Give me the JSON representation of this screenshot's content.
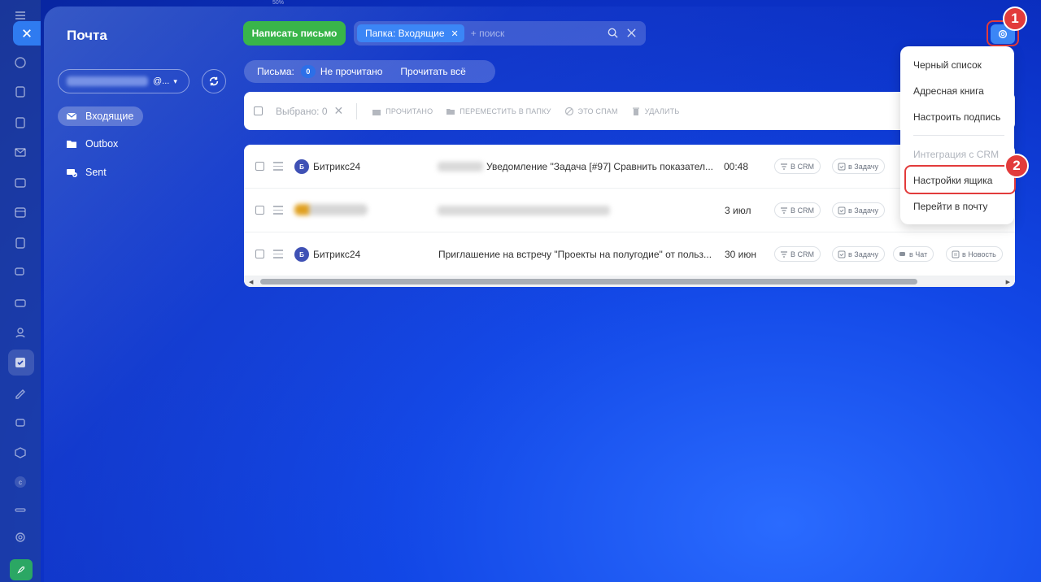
{
  "app": {
    "title": "Почта",
    "topline": "50%"
  },
  "sidebar": {
    "account_domain": "@...",
    "folders": [
      {
        "label": "Входящие",
        "active": true
      },
      {
        "label": "Outbox",
        "active": false
      },
      {
        "label": "Sent",
        "active": false
      }
    ]
  },
  "toolbar": {
    "compose_label": "Написать письмо",
    "filter_chip": "Папка: Входящие",
    "search_placeholder": "+ поиск"
  },
  "counter": {
    "label": "Письма:",
    "count": "0",
    "unread_label": "Не прочитано",
    "read_all_label": "Прочитать всё"
  },
  "action_bar": {
    "selected": "Выбрано: 0",
    "mark_read": "ПРОЧИТАНО",
    "move": "ПЕРЕМЕСТИТЬ В ПАПКУ",
    "spam": "ЭТО СПАМ",
    "delete": "УДАЛИТЬ"
  },
  "rows": [
    {
      "avatar": "Б",
      "sender": "Битрикс24",
      "subject": "Уведомление \"Задача [#97] Сравнить показател...",
      "date": "00:48",
      "tags": [
        "В CRM",
        "в Задачу"
      ]
    },
    {
      "avatar": "",
      "sender": "",
      "subject": "",
      "date": "3 июл",
      "tags": [
        "В CRM",
        "в Задачу"
      ]
    },
    {
      "avatar": "Б",
      "sender": "Битрикс24",
      "subject": "Приглашение на встречу \"Проекты на полугодие\" от польз...",
      "date": "30 июн",
      "tags": [
        "В CRM",
        "в Задачу",
        "в Чат",
        "в Новость"
      ]
    }
  ],
  "menu": {
    "items": [
      "Черный список",
      "Адресная книга",
      "Настроить подпись",
      "Интеграция с CRM",
      "Настройки ящика",
      "Перейти в почту"
    ]
  },
  "callouts": {
    "one": "1",
    "two": "2"
  },
  "colors": {
    "accent": "#3b86f6",
    "compose": "#39b54a",
    "highlight": "#e23b3b"
  }
}
